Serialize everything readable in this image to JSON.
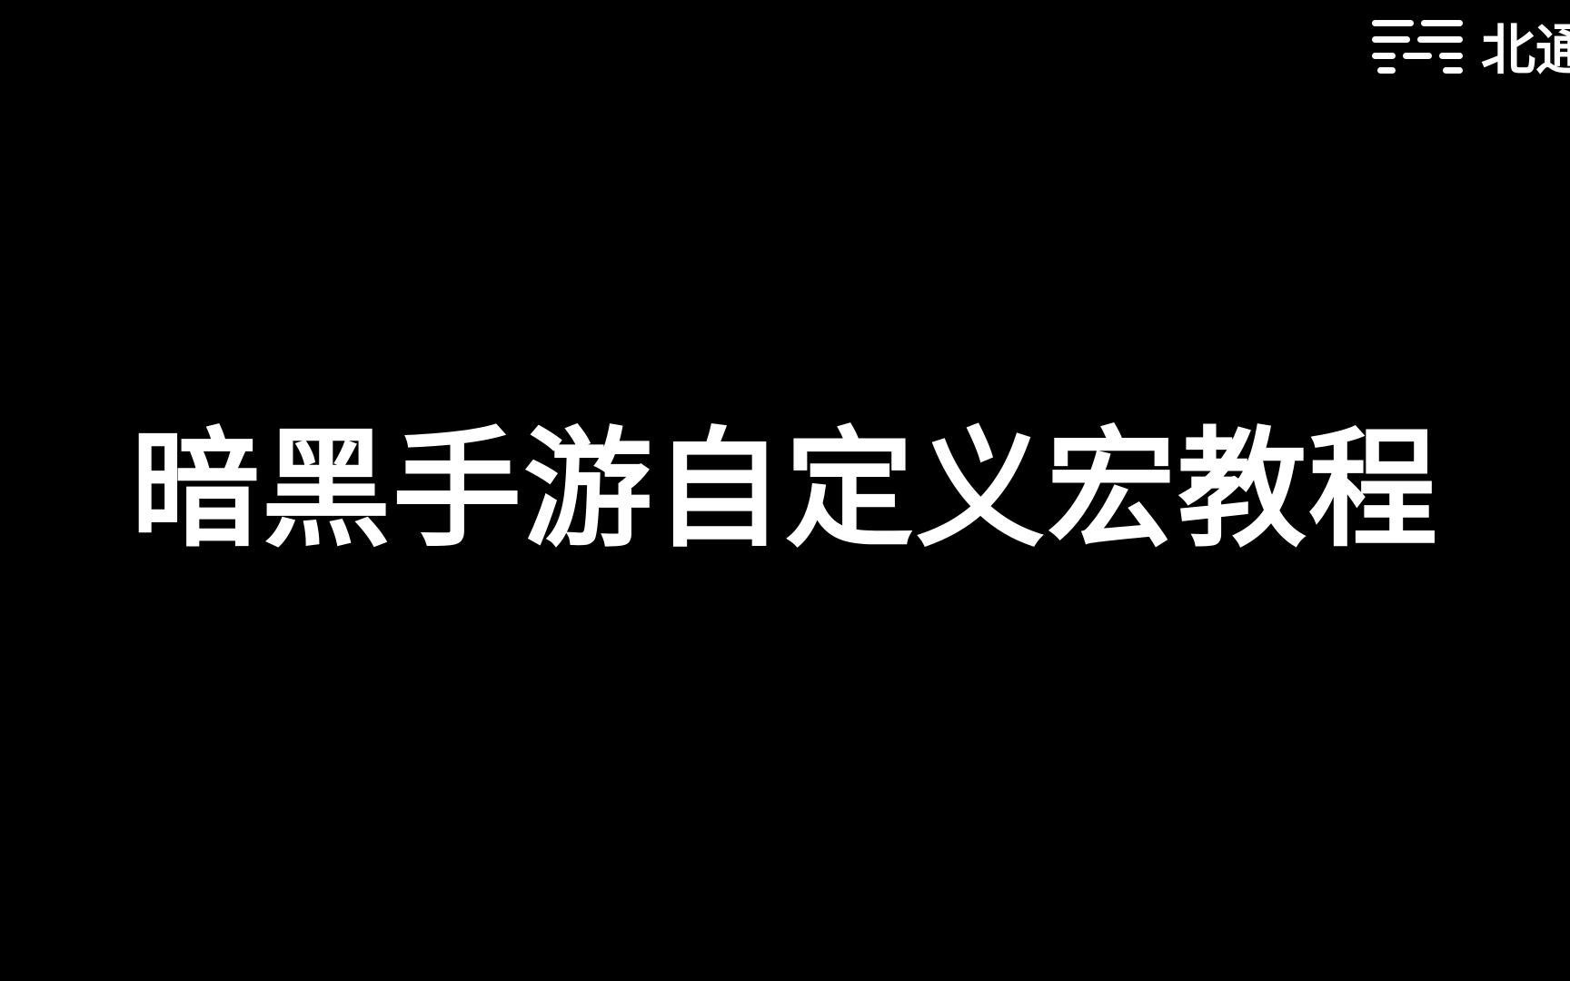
{
  "video": {
    "title": "暗黑手游自定义宏教程"
  },
  "watermark": {
    "icon": "watermark-logo-icon",
    "text": "北通",
    "color": "#ffffff"
  },
  "colors": {
    "background": "#000000",
    "text": "#ffffff"
  }
}
